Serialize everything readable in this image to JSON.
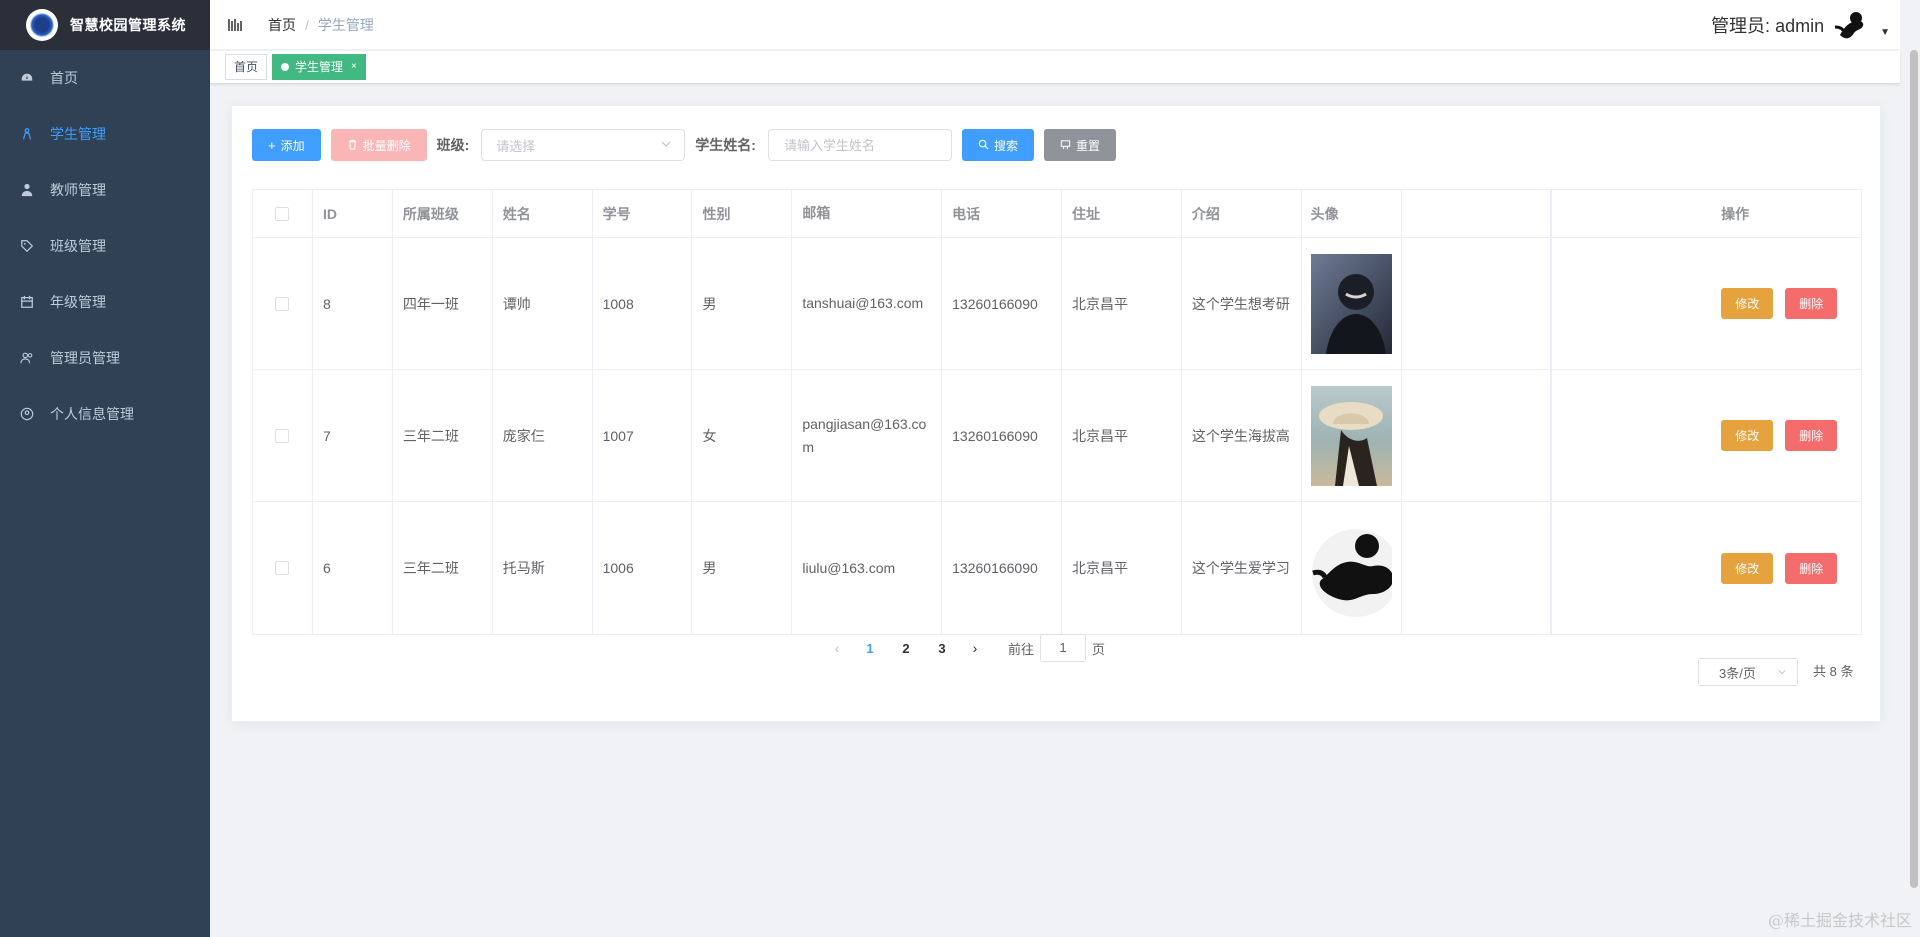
{
  "app": {
    "title": "智慧校园管理系统"
  },
  "sidebar": {
    "items": [
      {
        "label": "首页",
        "icon": "dashboard-icon",
        "active": false
      },
      {
        "label": "学生管理",
        "icon": "student-icon",
        "active": true
      },
      {
        "label": "教师管理",
        "icon": "teacher-icon",
        "active": false
      },
      {
        "label": "班级管理",
        "icon": "tag-icon",
        "active": false
      },
      {
        "label": "年级管理",
        "icon": "calendar-icon",
        "active": false
      },
      {
        "label": "管理员管理",
        "icon": "people-icon",
        "active": false
      },
      {
        "label": "个人信息管理",
        "icon": "user-circle-icon",
        "active": false
      }
    ]
  },
  "header": {
    "breadcrumb": {
      "home": "首页",
      "separator": "/",
      "current": "学生管理"
    },
    "user_label": "管理员: admin"
  },
  "tags": {
    "home": "首页",
    "active": "学生管理",
    "close": "×"
  },
  "toolbar": {
    "add_label": "添加",
    "batch_delete_label": "批量删除",
    "class_label": "班级:",
    "class_placeholder": "请选择",
    "name_label": "学生姓名:",
    "name_placeholder": "请输入学生姓名",
    "search_label": "搜索",
    "reset_label": "重置"
  },
  "table": {
    "columns": [
      "ID",
      "所属班级",
      "姓名",
      "学号",
      "性别",
      "邮箱",
      "电话",
      "住址",
      "介绍",
      "头像",
      "操作"
    ],
    "rows": [
      {
        "id": "8",
        "class": "四年一班",
        "name": "谭帅",
        "no": "1008",
        "sex": "男",
        "email": "tanshuai@163.com",
        "tel": "13260166090",
        "addr": "北京昌平",
        "intro": "这个学生想考研"
      },
      {
        "id": "7",
        "class": "三年二班",
        "name": "庞家仨",
        "no": "1007",
        "sex": "女",
        "email": "pangjiasan@163.com",
        "tel": "13260166090",
        "addr": "北京昌平",
        "intro": "这个学生海拔高"
      },
      {
        "id": "6",
        "class": "三年二班",
        "name": "托马斯",
        "no": "1006",
        "sex": "男",
        "email": "liulu@163.com",
        "tel": "13260166090",
        "addr": "北京昌平",
        "intro": "这个学生爱学习"
      }
    ],
    "edit_label": "修改",
    "delete_label": "删除"
  },
  "pagination": {
    "pages": [
      "1",
      "2",
      "3"
    ],
    "current": "1",
    "goto_prefix": "前往",
    "goto_value": "1",
    "goto_suffix": "页",
    "page_size": "3条/页",
    "total": "共 8 条"
  },
  "watermark": "@稀土掘金技术社区",
  "colors": {
    "sidebar_bg": "#304156",
    "primary": "#409eff",
    "tag_active": "#42b983",
    "warning": "#e6a23c",
    "danger": "#f56c6c"
  }
}
